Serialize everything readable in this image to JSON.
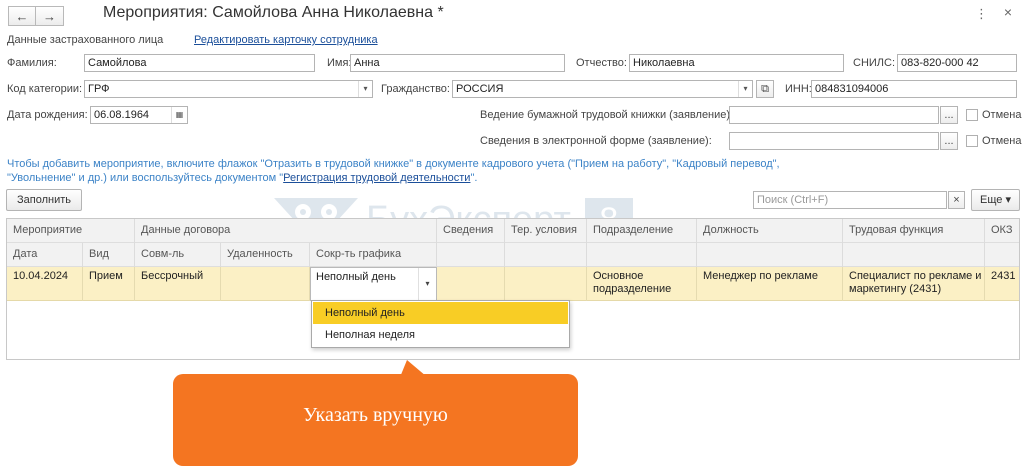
{
  "window": {
    "title": "Мероприятия: Самойлова Анна Николаевна *",
    "back_icon": "←",
    "forward_icon": "→",
    "menu_icon": "⋮",
    "close_icon": "×"
  },
  "insured": {
    "section_label": "Данные застрахованного лица",
    "edit_link": "Редактировать карточку сотрудника"
  },
  "fields": {
    "surname_label": "Фамилия:",
    "surname_value": "Самойлова",
    "name_label": "Имя:",
    "name_value": "Анна",
    "patronymic_label": "Отчество:",
    "patronymic_value": "Николаевна",
    "snils_label": "СНИЛС:",
    "snils_value": "083-820-000 42",
    "category_label": "Код категории:",
    "category_value": "ГРФ",
    "citizenship_label": "Гражданство:",
    "citizenship_value": "РОССИЯ",
    "inn_label": "ИНН:",
    "inn_value": "084831094006",
    "birth_label": "Дата рождения:",
    "birth_value": "06.08.1964",
    "paper_book_label": "Ведение бумажной трудовой книжки (заявление):",
    "paper_book_value": "",
    "electronic_label": "Сведения в электронной форме (заявление):",
    "electronic_value": "",
    "cancel_label_1": "Отмена",
    "cancel_label_2": "Отмена",
    "dots": "...",
    "dropdown_arrow": "▾",
    "open_icon": "⧉",
    "calendar_icon": "▦"
  },
  "hint": {
    "text_before": "Чтобы добавить мероприятие, включите флажок \"Отразить в трудовой книжке\" в документе кадрового учета (\"Прием на работу\", \"Кадровый перевод\", \"Увольнение\" и др.) или воспользуйтесь документом \"",
    "link": "Регистрация трудовой деятельности",
    "text_after": "\"."
  },
  "toolbar": {
    "fill_button": "Заполнить",
    "search_placeholder": "Поиск (Ctrl+F)",
    "clear_icon": "×",
    "more_button": "Еще ▾"
  },
  "watermark": {
    "text": "БухЭксперт",
    "number": "8"
  },
  "table": {
    "header_top": [
      "Мероприятие",
      "Данные договора",
      "Сведения",
      "Тер. условия",
      "Подразделение",
      "Должность",
      "Трудовая функция",
      "ОКЗ"
    ],
    "header_sub": [
      "Дата",
      "Вид",
      "Совм-ль",
      "Удаленность",
      "Сокр-ть графика"
    ],
    "row": {
      "date": "10.04.2024",
      "type": "Прием",
      "combination": "Бессрочный",
      "remote": "",
      "schedule": "Неполный день",
      "info": "",
      "territory": "",
      "department": "Основное подразделение",
      "position": "Менеджер по рекламе",
      "function": "Специалист по рекламе и маркетингу (2431)",
      "okz": "2431"
    }
  },
  "dropdown": {
    "options": [
      "Неполный день",
      "Неполная неделя"
    ],
    "selected_index": 0
  },
  "callout": {
    "text": "Указать вручную",
    "color": "#f47521"
  }
}
